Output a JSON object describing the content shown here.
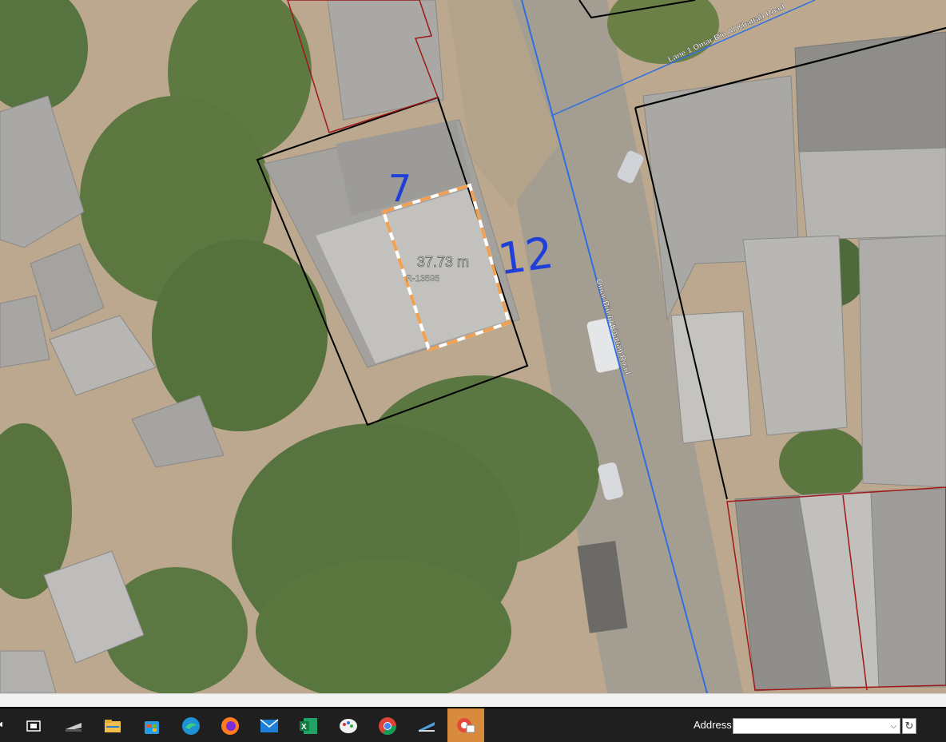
{
  "map": {
    "measurement_label": "37.73 m",
    "parcel_id": "R-13595",
    "road_main": "Omar Bin Al Khattab Road",
    "road_lane": "Lane 1 Omar Bin Al Khattab Road",
    "handwritten_width": "7",
    "handwritten_length": "12"
  },
  "colors": {
    "parcel_outline": "#000000",
    "neighbor_parcel": "#a01818",
    "road_line": "#2f6fe0",
    "measure_orange": "#f0a050",
    "handwriting": "#1f3fd8"
  },
  "taskbar": {
    "icons": [
      "task-view-icon",
      "scanner-icon",
      "file-explorer-icon",
      "store-icon",
      "edge-icon",
      "firefox-icon",
      "mail-icon",
      "excel-icon",
      "paint-icon",
      "chrome-icon",
      "scan-tool-icon",
      "remote-app-icon"
    ],
    "address_label": "Address",
    "address_value": "",
    "refresh_glyph": "↻",
    "dropdown_glyph": "⌵"
  }
}
